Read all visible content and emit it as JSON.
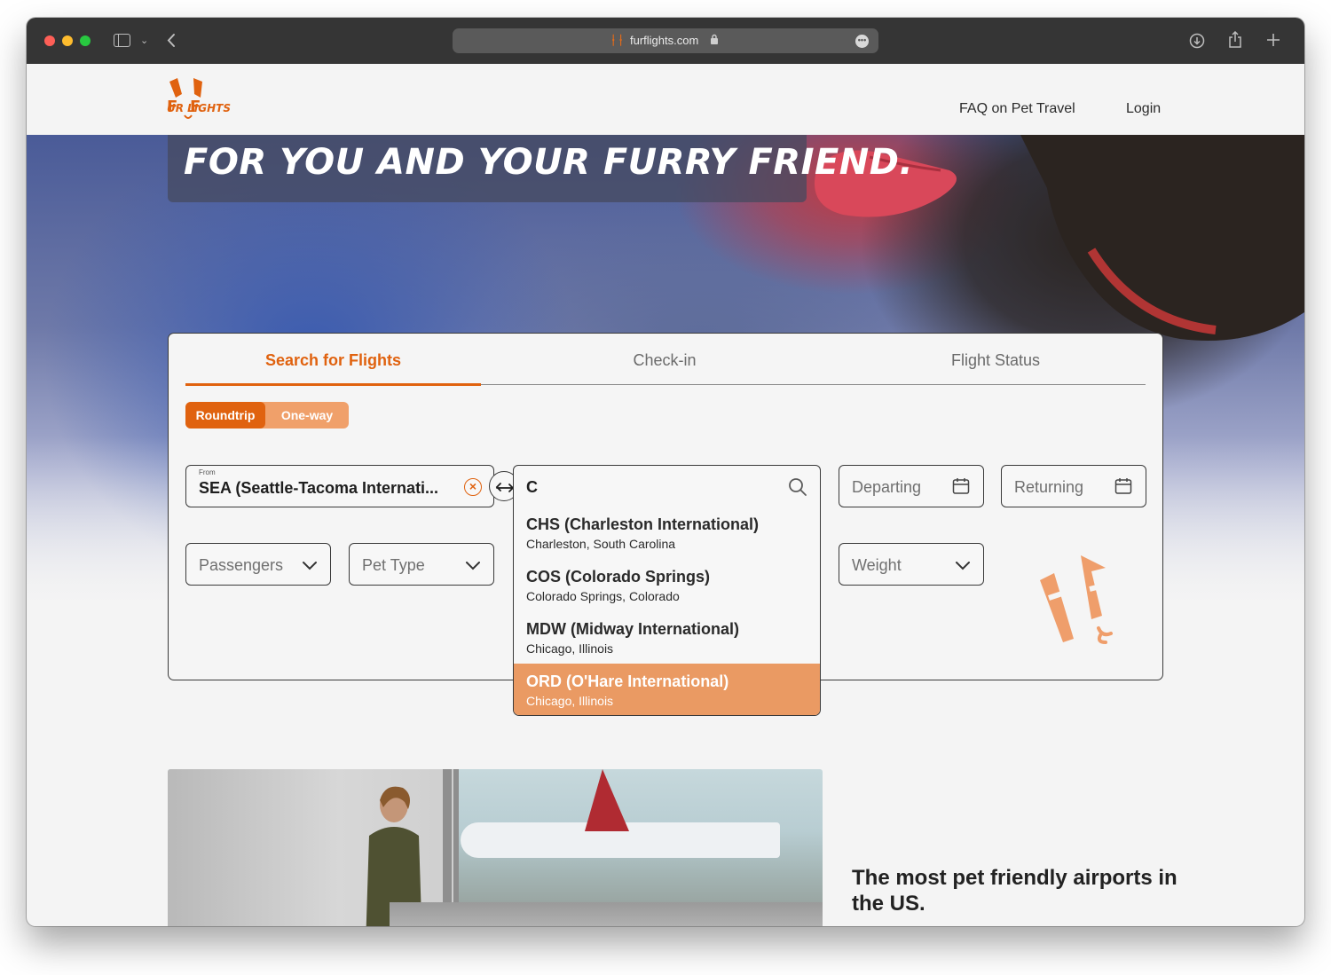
{
  "browser": {
    "url": "furflights.com"
  },
  "header": {
    "logo_text": "FUR FLIGHTS",
    "nav": [
      "FAQ on Pet Travel",
      "Login"
    ]
  },
  "hero": {
    "title": "For you and your furry friend."
  },
  "search": {
    "tabs": [
      "Search for Flights",
      "Check-in",
      "Flight Status"
    ],
    "trip_types": [
      "Roundtrip",
      "One-way"
    ],
    "from": {
      "label": "From",
      "value": "SEA (Seattle-Tacoma Internati..."
    },
    "to": {
      "value": "C"
    },
    "departing_placeholder": "Departing",
    "returning_placeholder": "Returning",
    "passengers_placeholder": "Passengers",
    "pet_type_placeholder": "Pet Type",
    "weight_placeholder": "Weight",
    "suggestions": [
      {
        "code": "CHS (Charleston International)",
        "city": "Charleston, South Carolina"
      },
      {
        "code": "COS (Colorado Springs)",
        "city": "Colorado Springs, Colorado"
      },
      {
        "code": "MDW (Midway International)",
        "city": "Chicago, Illinois"
      },
      {
        "code": "ORD (O'Hare International)",
        "city": "Chicago, Illinois"
      }
    ]
  },
  "feature": {
    "title": "The most pet friendly airports in the US."
  },
  "colors": {
    "brand_orange": "#e0620f",
    "highlight_orange": "#ea9a63"
  }
}
